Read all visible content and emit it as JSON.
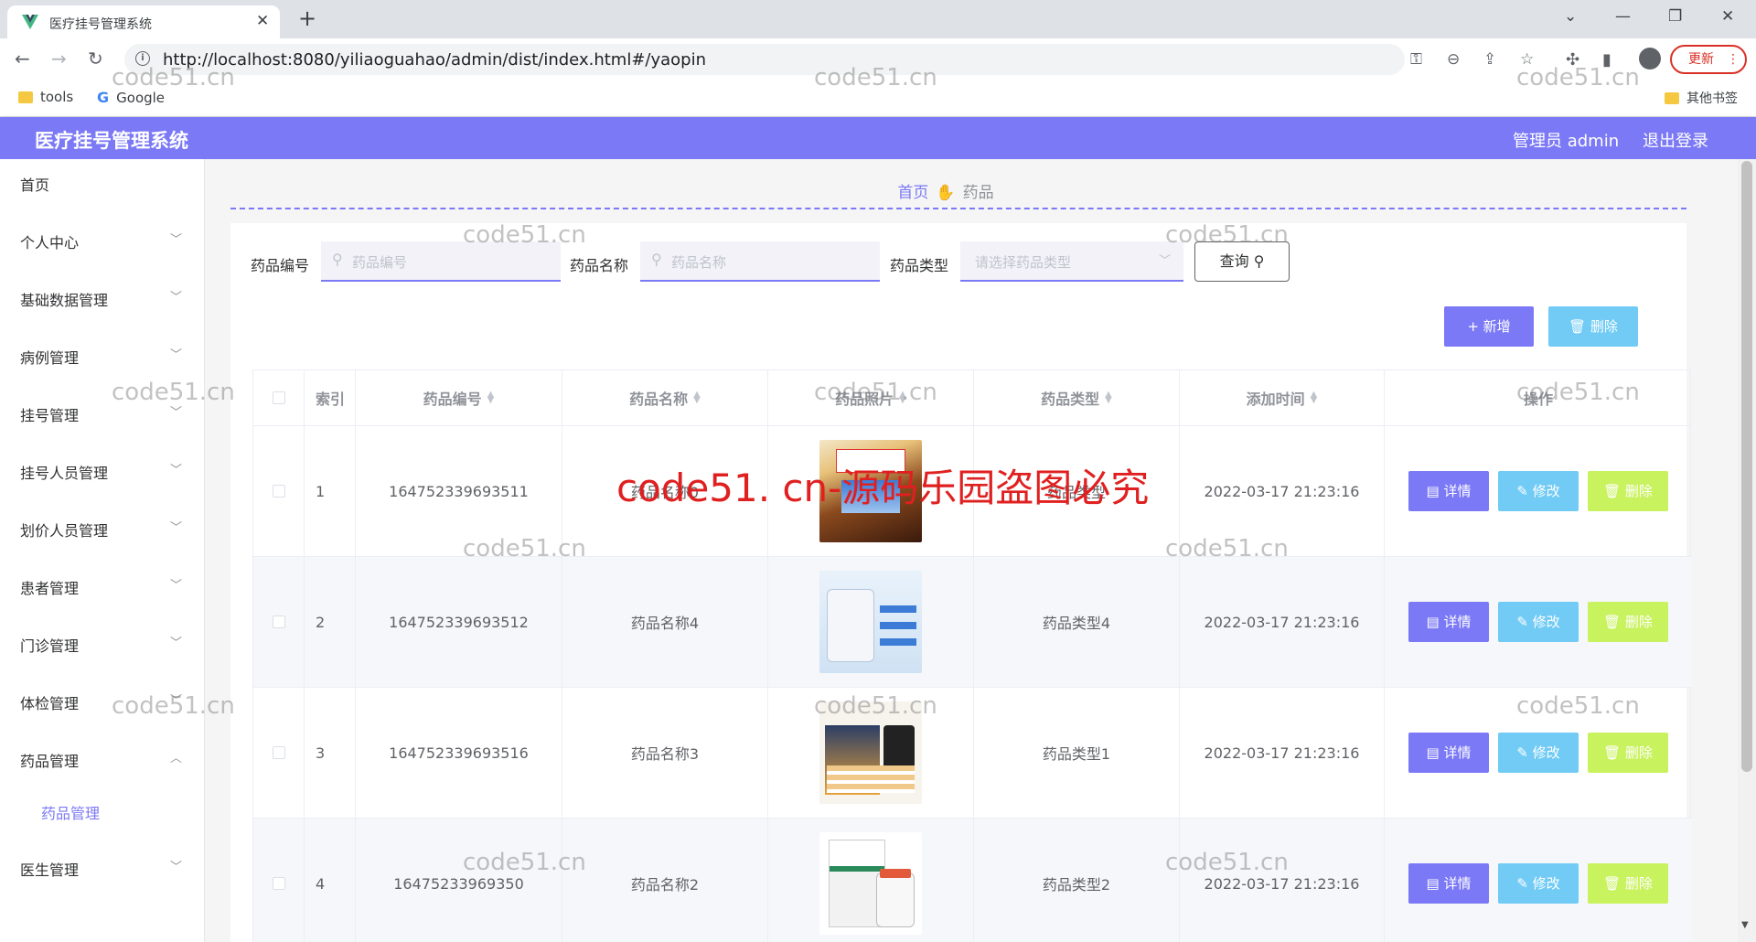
{
  "browser": {
    "tab_title": "医疗挂号管理系统",
    "url": "http://localhost:8080/yiliaoguahao/admin/dist/index.html#/yaopin",
    "update_label": "更新",
    "bookmarks": [
      "tools",
      "Google"
    ],
    "other_bookmarks": "其他书签"
  },
  "header": {
    "title": "医疗挂号管理系统",
    "user": "管理员 admin",
    "logout": "退出登录"
  },
  "sidebar": {
    "items": [
      {
        "label": "首页"
      },
      {
        "label": "个人中心"
      },
      {
        "label": "基础数据管理"
      },
      {
        "label": "病例管理"
      },
      {
        "label": "挂号管理"
      },
      {
        "label": "挂号人员管理"
      },
      {
        "label": "划价人员管理"
      },
      {
        "label": "患者管理"
      },
      {
        "label": "门诊管理"
      },
      {
        "label": "体检管理"
      },
      {
        "label": "药品管理"
      },
      {
        "label": "药品管理"
      },
      {
        "label": "医生管理"
      }
    ]
  },
  "breadcrumb": {
    "home": "首页",
    "current": "药品"
  },
  "search": {
    "code_label": "药品编号",
    "code_placeholder": "药品编号",
    "name_label": "药品名称",
    "name_placeholder": "药品名称",
    "type_label": "药品类型",
    "type_placeholder": "请选择药品类型",
    "query_label": "查询"
  },
  "toolbar": {
    "add_label": "+ 新增",
    "delete_label": "删除"
  },
  "table": {
    "columns": [
      "索引",
      "药品编号",
      "药品名称",
      "药品照片",
      "药品类型",
      "添加时间",
      "操作"
    ],
    "rows": [
      {
        "index": "1",
        "code": "164752339693511",
        "name": "药品名称0",
        "type": "药品类型",
        "time": "2022-03-17 21:23:16"
      },
      {
        "index": "2",
        "code": "164752339693512",
        "name": "药品名称4",
        "type": "药品类型4",
        "time": "2022-03-17 21:23:16"
      },
      {
        "index": "3",
        "code": "164752339693516",
        "name": "药品名称3",
        "type": "药品类型1",
        "time": "2022-03-17 21:23:16"
      },
      {
        "index": "4",
        "code": "16475233969350",
        "name": "药品名称2",
        "type": "药品类型2",
        "time": "2022-03-17 21:23:16"
      }
    ],
    "actions": {
      "detail": "详情",
      "edit": "修改",
      "remove": "删除"
    }
  },
  "watermark": {
    "small": "code51.cn",
    "big": "code51. cn-源码乐园盗图必究"
  },
  "colors": {
    "primary": "#7b79f5",
    "info": "#71cbf5",
    "lime": "#c9f25f"
  }
}
